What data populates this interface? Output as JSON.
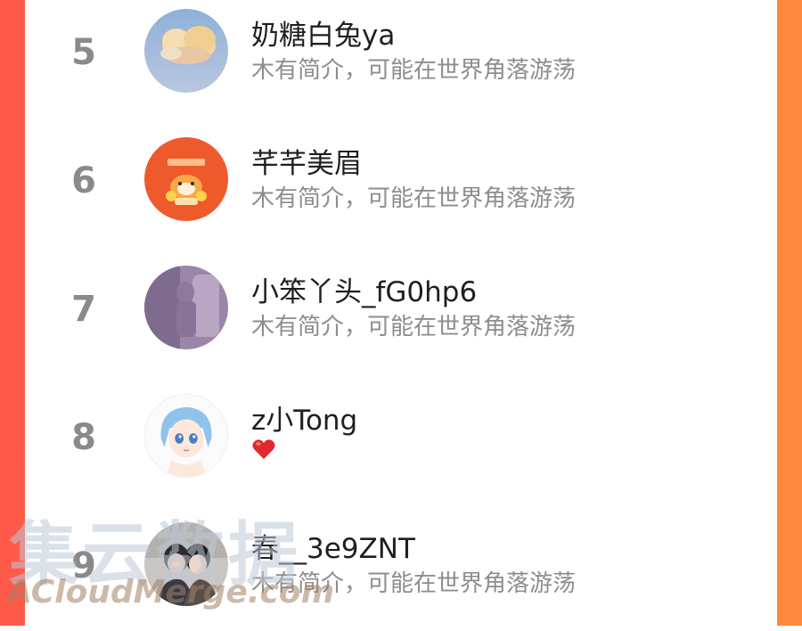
{
  "list": {
    "items": [
      {
        "rank": "5",
        "name": "奶糖白兔ya",
        "bio": "木有简介，可能在世界角落游荡",
        "avatar_icon": "cloud-avatar-icon"
      },
      {
        "rank": "6",
        "name": "芊芊美眉",
        "bio": "木有简介，可能在世界角落游荡",
        "avatar_icon": "tiger-avatar-icon"
      },
      {
        "rank": "7",
        "name": "小笨丫头_fG0hp6",
        "bio": "木有简介，可能在世界角落游荡",
        "avatar_icon": "purple-photo-avatar-icon"
      },
      {
        "rank": "8",
        "name": "z小Tong",
        "bio": "",
        "bio_emoji": "heart-icon",
        "avatar_icon": "anime-girl-avatar-icon"
      },
      {
        "rank": "9",
        "name": "春__3e9ZNT",
        "bio": "木有简介，可能在世界角落游荡",
        "avatar_icon": "couple-photo-avatar-icon"
      }
    ]
  },
  "watermark": {
    "text_cn": "集云数据",
    "text_en": "ACloudMerge.com"
  },
  "colors": {
    "frame_left": "#ff5a4a",
    "frame_right": "#ff8a3d",
    "card_bg": "#ffffff",
    "rank": "#8a8a8a",
    "name": "#1f1f1f",
    "bio": "#8d8d8d",
    "heart": "#e0282e"
  }
}
